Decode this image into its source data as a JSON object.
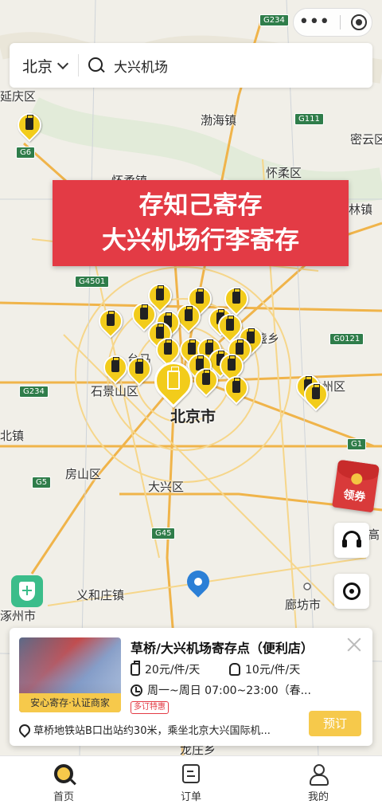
{
  "search": {
    "city": "北京",
    "query": "大兴机场"
  },
  "banner": {
    "line1": "存知己寄存",
    "line2": "大兴机场行李寄存"
  },
  "map": {
    "places": [
      "延庆区",
      "渤海镇",
      "密云区",
      "怀柔区",
      "林镇",
      "金盏乡",
      "石景山区",
      "北京市",
      "州区",
      "北镇",
      "房山区",
      "大兴区",
      "义和庄镇",
      "廊坊市",
      "涿州市",
      "龙庄乡",
      "高",
      "怀柔镇",
      "台马"
    ],
    "roads": [
      "G234",
      "G111",
      "G6",
      "G4501",
      "G0121",
      "G234",
      "G1",
      "G5",
      "G45"
    ]
  },
  "coupon": {
    "label": "领券"
  },
  "card": {
    "store_name": "草桥/大兴机场寄存点（便利店）",
    "merchant_badge": "安心寄存·认证商家",
    "price_luggage": "20元/件/天",
    "price_bag": "10元/件/天",
    "hours": "周一~周日 07:00~23:00（春...",
    "promo": "多订特惠",
    "address": "草桥地铁站B口出站约30米，乘坐北京大兴国际机...",
    "book_label": "预订"
  },
  "tabs": [
    {
      "label": "首页"
    },
    {
      "label": "订单"
    },
    {
      "label": "我的"
    }
  ]
}
